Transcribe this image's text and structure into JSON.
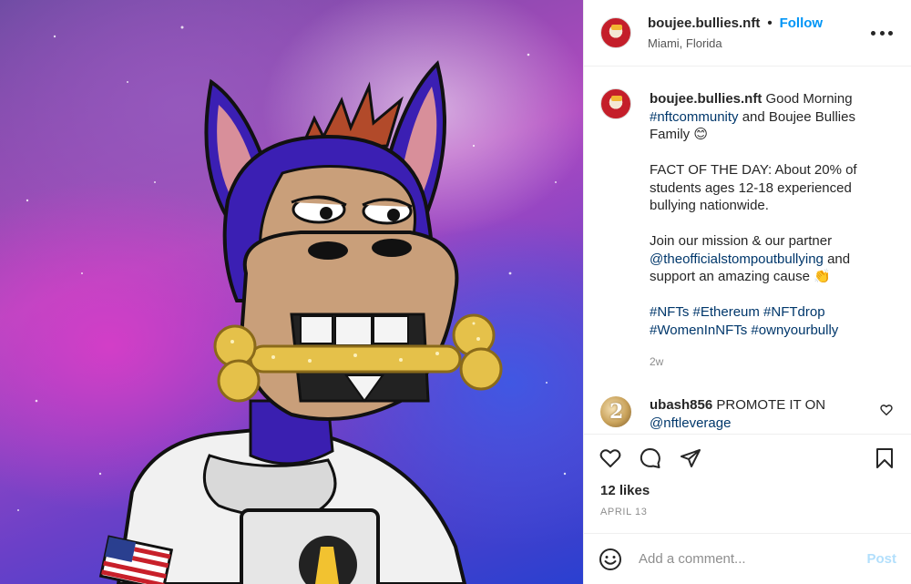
{
  "post": {
    "username": "boujee.bullies.nft",
    "follow_label": "Follow",
    "separator": "•",
    "location": "Miami, Florida"
  },
  "caption": {
    "username": "boujee.bullies.nft",
    "line1_text": " Good Morning ",
    "line1_tag": "#nftcommunity",
    "line1_rest": " and Boujee Bullies Family 😊",
    "fact": "FACT OF THE DAY: About 20% of students ages 12-18 experienced bullying nationwide.",
    "join_text": "Join our mission & our partner ",
    "join_mention": "@theofficialstompoutbullying",
    "join_rest": " and support an amazing cause 👏",
    "hashtags": "#NFTs #Ethereum #NFTdrop #WomenInNFTs #ownyourbully",
    "time": "2w"
  },
  "comment": {
    "username": "ubash856",
    "text": " PROMOTE IT ON ",
    "mention": "@nftleverage"
  },
  "stats": {
    "likes": "12 likes",
    "date": "APRIL 13"
  },
  "add_comment": {
    "placeholder": "Add a comment...",
    "post_label": "Post"
  },
  "icons": {
    "like": "heart-icon",
    "comment": "comment-bubble-icon",
    "share": "paper-plane-icon",
    "save": "bookmark-icon",
    "more": "more-dots-icon",
    "emoji": "emoji-smiley-icon"
  },
  "colors": {
    "link": "#0095f6",
    "hashtag": "#00376b",
    "muted": "#8e8e8e",
    "post_disabled": "#b2dffc"
  }
}
